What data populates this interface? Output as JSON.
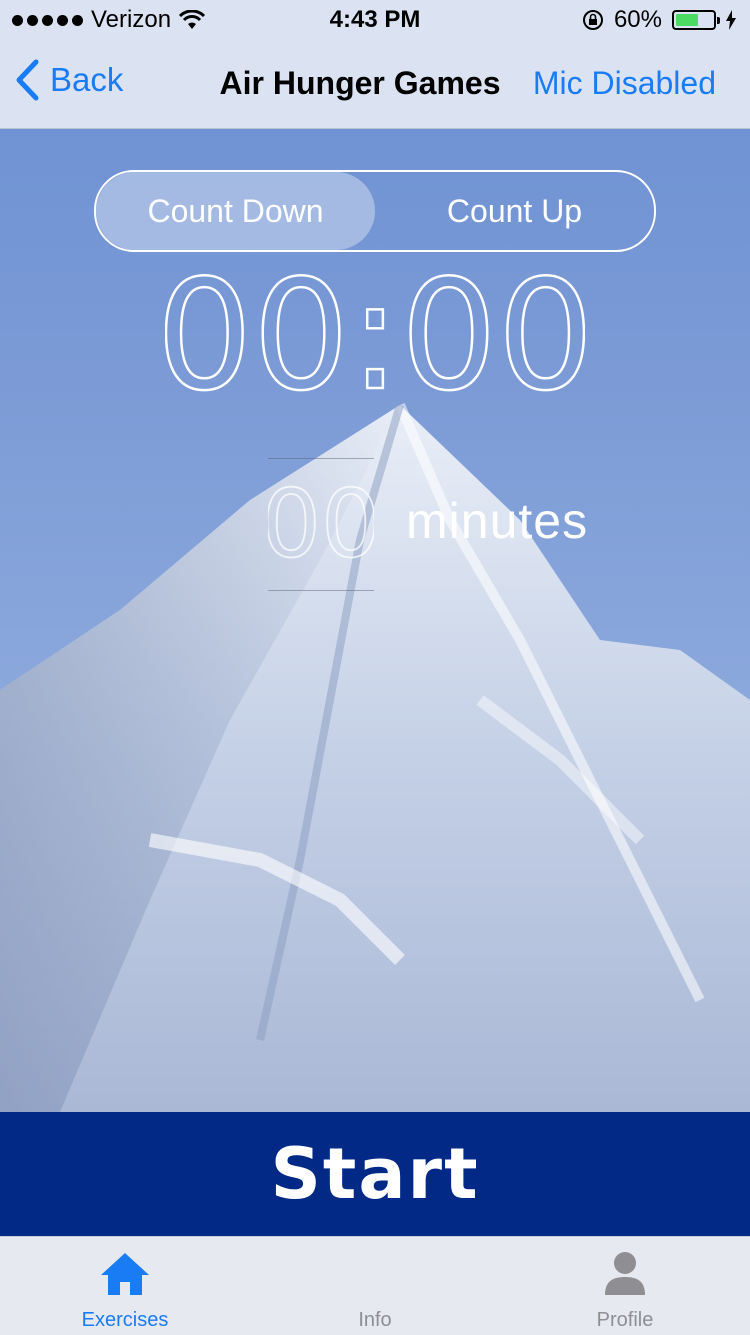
{
  "status_bar": {
    "carrier": "Verizon",
    "time": "4:43 PM",
    "battery_percent": "60%",
    "battery_level": 0.6
  },
  "nav": {
    "back_label": "Back",
    "title": "Air Hunger Games",
    "right_label": "Mic Disabled"
  },
  "mode_toggle": {
    "options": [
      "Count Down",
      "Count Up"
    ],
    "selected": "Count Down"
  },
  "timer": {
    "display": "00:00"
  },
  "picker": {
    "value": "00",
    "unit": "minutes"
  },
  "start_label": "Start",
  "tabs": [
    {
      "label": "Exercises",
      "icon": "home-icon",
      "active": true
    },
    {
      "label": "Info",
      "icon": "info-icon",
      "active": false
    },
    {
      "label": "Profile",
      "icon": "person-icon",
      "active": false
    }
  ],
  "colors": {
    "accent": "#1a7cf4",
    "start_bg": "#022986",
    "battery_fill": "#4cd964"
  }
}
